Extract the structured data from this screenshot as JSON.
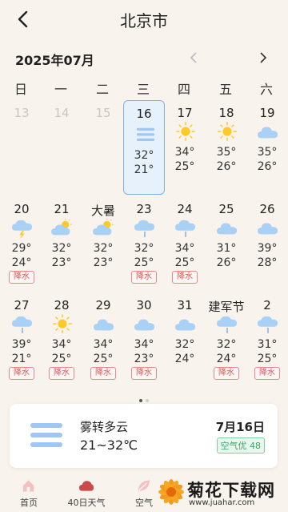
{
  "header": {
    "title": "北京市"
  },
  "month": {
    "label": "2025年07月"
  },
  "weekdays": [
    "日",
    "一",
    "二",
    "三",
    "四",
    "五",
    "六"
  ],
  "weeks": [
    [
      {
        "num": "13",
        "dim": true
      },
      {
        "num": "14",
        "dim": true
      },
      {
        "num": "15",
        "dim": true
      },
      {
        "num": "16",
        "icon": "fog-icon",
        "hi": "32°",
        "lo": "21°",
        "today": true
      },
      {
        "num": "17",
        "icon": "sun-icon",
        "hi": "34°",
        "lo": "25°"
      },
      {
        "num": "18",
        "icon": "sun-icon",
        "hi": "35°",
        "lo": "26°"
      },
      {
        "num": "19",
        "icon": "cloud-icon",
        "hi": "35°",
        "lo": "26°"
      }
    ],
    [
      {
        "num": "20",
        "icon": "thunder-icon",
        "hi": "29°",
        "lo": "24°",
        "badge": "降水"
      },
      {
        "num": "21",
        "icon": "partly-cloudy-icon",
        "hi": "32°",
        "lo": "23°"
      },
      {
        "num": "大暑",
        "icon": "partly-cloudy-icon",
        "hi": "32°",
        "lo": "23°"
      },
      {
        "num": "23",
        "icon": "rain-icon",
        "hi": "32°",
        "lo": "25°",
        "badge": "降水"
      },
      {
        "num": "24",
        "icon": "rain-icon",
        "hi": "34°",
        "lo": "25°",
        "badge": "降水"
      },
      {
        "num": "25",
        "icon": "cloud-icon",
        "hi": "31°",
        "lo": "26°"
      },
      {
        "num": "26",
        "icon": "cloud-icon",
        "hi": "39°",
        "lo": "28°"
      }
    ],
    [
      {
        "num": "27",
        "icon": "rain-icon",
        "hi": "39°",
        "lo": "21°",
        "badge": "降水"
      },
      {
        "num": "28",
        "icon": "sun-icon",
        "hi": "34°",
        "lo": "25°",
        "badge": "降水"
      },
      {
        "num": "29",
        "icon": "cloud-icon",
        "hi": "34°",
        "lo": "25°",
        "badge": "降水"
      },
      {
        "num": "30",
        "icon": "cloud-icon",
        "hi": "34°",
        "lo": "23°",
        "badge": "降水"
      },
      {
        "num": "31",
        "icon": "cloud-icon",
        "hi": "32°",
        "lo": "24°"
      },
      {
        "num": "建军节",
        "icon": "rain-icon",
        "hi": "32°",
        "lo": "24°",
        "badge": "降水"
      },
      {
        "num": "2",
        "icon": "rain-icon",
        "hi": "31°",
        "lo": "25°",
        "badge": "降水"
      }
    ]
  ],
  "card": {
    "condition": "雾转多云",
    "range": "21~32℃",
    "date": "7月16日",
    "air": "空气优 48"
  },
  "tabs": [
    {
      "label": "首页",
      "icon": "home-icon"
    },
    {
      "label": "40日天气",
      "icon": "calendar-cloud-icon"
    },
    {
      "label": "空气",
      "icon": "leaf-icon"
    }
  ],
  "watermark": {
    "title": "菊花下载网",
    "url": "www.juahar.com"
  },
  "colors": {
    "accent": "#7fb2e5",
    "badge": "#d35a5a",
    "air": "#3aa86b",
    "background": "#f8f3ec"
  }
}
